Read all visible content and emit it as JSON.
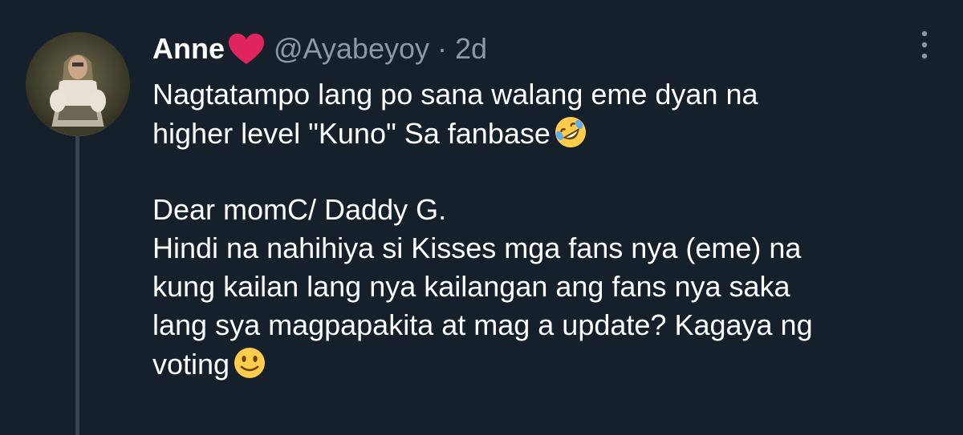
{
  "tweet": {
    "display_name": "Anne",
    "handle": "@Ayabeyoy",
    "separator": "·",
    "time": "2d",
    "name_emoji": "red-heart",
    "lines": [
      "Nagtatampo lang po sana walang eme dyan na",
      "higher level \"Kuno\" Sa fanbase",
      "",
      "Dear momC/ Daddy G.",
      "Hindi na nahihiya si Kisses mga fans nya (eme) na",
      "kung kailan lang nya kailangan ang fans nya saka",
      "lang sya magpapakita at mag a update? Kagaya ng",
      "voting"
    ],
    "line_emojis": {
      "1": "rolling-on-floor-laughing",
      "7": "slightly-smiling-face"
    }
  },
  "colors": {
    "background": "#15202b",
    "text": "#ffffff",
    "secondary_text": "#8b98a5",
    "thread_line": "#38444d",
    "heart": "#e0245e"
  }
}
